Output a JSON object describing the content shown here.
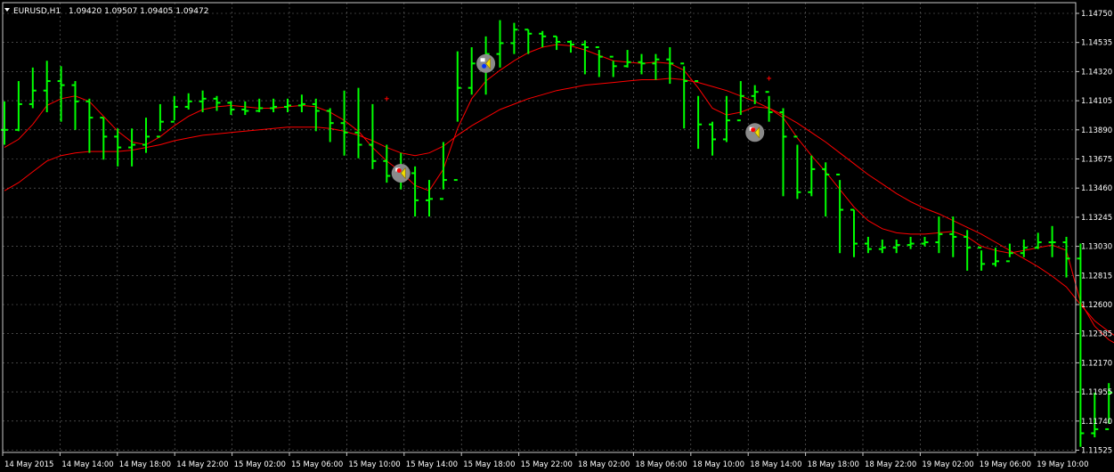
{
  "header": {
    "symbol": "EURUSD,H1",
    "quote": "1.09420 1.09507 1.09405 1.09472"
  },
  "colors": {
    "background": "#000000",
    "grid": "#6e6e6e",
    "bar": "#00ff00",
    "ma": "#ff0000",
    "axis_text": "#ffffff",
    "frame": "#c8c8c8"
  },
  "chart_data": {
    "type": "ohlc",
    "timeframe": "H1",
    "grid": true,
    "ylim": [
      1.11525,
      1.1475
    ],
    "y_ticks": [
      "1.14750",
      "1.14535",
      "1.14320",
      "1.14105",
      "1.13890",
      "1.13675",
      "1.13460",
      "1.13245",
      "1.13030",
      "1.12815",
      "1.12600",
      "1.12385",
      "1.12170",
      "1.11955",
      "1.11740",
      "1.11525"
    ],
    "x_ticks": [
      "14 May 2015",
      "14 May 14:00",
      "14 May 18:00",
      "14 May 22:00",
      "15 May 02:00",
      "15 May 06:00",
      "15 May 10:00",
      "15 May 14:00",
      "15 May 18:00",
      "15 May 22:00",
      "18 May 02:00",
      "18 May 06:00",
      "18 May 10:00",
      "18 May 14:00",
      "18 May 18:00",
      "18 May 22:00",
      "19 May 02:00",
      "19 May 06:00",
      "19 May 10:00"
    ],
    "series": [
      {
        "kind": "bars",
        "close": [
          1.1389,
          1.1408,
          1.1418,
          1.1425,
          1.1422,
          1.141,
          1.1398,
          1.1384,
          1.1376,
          1.1378,
          1.1384,
          1.1395,
          1.1406,
          1.141,
          1.1412,
          1.1409,
          1.1404,
          1.1403,
          1.1405,
          1.1406,
          1.1407,
          1.1408,
          1.1403,
          1.1394,
          1.1387,
          1.1378,
          1.1366,
          1.1355,
          1.1357,
          1.1337,
          1.1338,
          1.1352,
          1.142,
          1.1438,
          1.1445,
          1.1453,
          1.1463,
          1.146,
          1.1458,
          1.1454,
          1.1452,
          1.145,
          1.1443,
          1.1436,
          1.1439,
          1.1438,
          1.1441,
          1.1438,
          1.1425,
          1.1393,
          1.1382,
          1.1396,
          1.1414,
          1.1417,
          1.1402,
          1.1384,
          1.1343,
          1.136,
          1.1356,
          1.133,
          1.1305,
          1.1301,
          1.1302,
          1.1304,
          1.1305,
          1.1306,
          1.1312,
          1.131,
          1.1302,
          1.129,
          1.1292,
          1.1298,
          1.1302,
          1.1306,
          1.1306,
          1.1294,
          1.1165,
          1.1168,
          1.1195,
          1.1207
        ],
        "high": [
          1.141,
          1.1425,
          1.1435,
          1.144,
          1.1436,
          1.1425,
          1.1412,
          1.1398,
          1.139,
          1.139,
          1.1398,
          1.1408,
          1.1414,
          1.1416,
          1.1418,
          1.1414,
          1.141,
          1.141,
          1.1412,
          1.1412,
          1.1412,
          1.1415,
          1.1412,
          1.1405,
          1.1418,
          1.142,
          1.1408,
          1.1378,
          1.1372,
          1.1362,
          1.1352,
          1.138,
          1.1447,
          1.145,
          1.1458,
          1.147,
          1.1468,
          1.1463,
          1.1462,
          1.1458,
          1.1455,
          1.1455,
          1.1448,
          1.144,
          1.1448,
          1.1445,
          1.1445,
          1.145,
          1.1436,
          1.1414,
          1.1395,
          1.1414,
          1.1425,
          1.1422,
          1.1414,
          1.1405,
          1.1378,
          1.137,
          1.1365,
          1.1352,
          1.133,
          1.131,
          1.1308,
          1.1308,
          1.131,
          1.131,
          1.1325,
          1.1325,
          1.1315,
          1.13,
          1.1302,
          1.1305,
          1.1308,
          1.1313,
          1.1318,
          1.131,
          1.1305,
          1.1195,
          1.1202,
          1.1215
        ],
        "low": [
          1.1378,
          1.1388,
          1.1405,
          1.1402,
          1.1395,
          1.1389,
          1.1372,
          1.1367,
          1.1362,
          1.1362,
          1.1372,
          1.1388,
          1.1396,
          1.1404,
          1.1402,
          1.1403,
          1.14,
          1.14,
          1.1402,
          1.1402,
          1.1402,
          1.1402,
          1.1388,
          1.138,
          1.137,
          1.1368,
          1.136,
          1.135,
          1.1345,
          1.1325,
          1.1325,
          1.1345,
          1.1395,
          1.1415,
          1.1415,
          1.1435,
          1.1445,
          1.1445,
          1.145,
          1.1448,
          1.1446,
          1.143,
          1.1428,
          1.1428,
          1.1435,
          1.143,
          1.1426,
          1.1423,
          1.139,
          1.1375,
          1.137,
          1.138,
          1.14,
          1.1408,
          1.1395,
          1.134,
          1.1338,
          1.134,
          1.1325,
          1.1298,
          1.1295,
          1.1298,
          1.1298,
          1.1298,
          1.1301,
          1.1303,
          1.1298,
          1.1295,
          1.1285,
          1.1285,
          1.1288,
          1.1295,
          1.1295,
          1.1301,
          1.1295,
          1.128,
          1.1155,
          1.1162,
          1.1172,
          1.1195
        ]
      },
      {
        "kind": "line",
        "role": "fast-ma",
        "values": [
          1.1376,
          1.1382,
          1.1393,
          1.1407,
          1.1412,
          1.1414,
          1.141,
          1.1399,
          1.1388,
          1.138,
          1.1378,
          1.1384,
          1.1392,
          1.1399,
          1.1404,
          1.1406,
          1.1407,
          1.1406,
          1.1405,
          1.1405,
          1.1406,
          1.1407,
          1.1406,
          1.1402,
          1.1396,
          1.1388,
          1.1376,
          1.1366,
          1.1358,
          1.1348,
          1.1344,
          1.136,
          1.139,
          1.1412,
          1.1425,
          1.1433,
          1.144,
          1.1446,
          1.145,
          1.1452,
          1.1451,
          1.1448,
          1.1444,
          1.144,
          1.1439,
          1.1438,
          1.1439,
          1.1438,
          1.1433,
          1.142,
          1.1405,
          1.14,
          1.1402,
          1.1406,
          1.1405,
          1.1398,
          1.1383,
          1.137,
          1.1358,
          1.1345,
          1.1332,
          1.1322,
          1.1316,
          1.1313,
          1.1312,
          1.1312,
          1.1313,
          1.1314,
          1.131,
          1.1303,
          1.13,
          1.1298,
          1.13,
          1.1302,
          1.1304,
          1.13,
          1.1262,
          1.1244,
          1.1234,
          1.1228
        ]
      },
      {
        "kind": "line",
        "role": "slow-ma",
        "values": [
          1.1344,
          1.135,
          1.1358,
          1.1366,
          1.137,
          1.1372,
          1.1373,
          1.1373,
          1.1373,
          1.1374,
          1.1376,
          1.1378,
          1.1381,
          1.1383,
          1.1385,
          1.1386,
          1.1387,
          1.1388,
          1.1389,
          1.139,
          1.1391,
          1.1391,
          1.1391,
          1.139,
          1.1388,
          1.1385,
          1.1381,
          1.1376,
          1.1372,
          1.137,
          1.1372,
          1.1377,
          1.1385,
          1.1392,
          1.1398,
          1.1404,
          1.1408,
          1.1412,
          1.1415,
          1.1418,
          1.142,
          1.1422,
          1.1423,
          1.1424,
          1.1425,
          1.1426,
          1.1426,
          1.1427,
          1.1426,
          1.1424,
          1.1421,
          1.1418,
          1.1414,
          1.141,
          1.1405,
          1.14,
          1.1394,
          1.1387,
          1.138,
          1.1372,
          1.1364,
          1.1356,
          1.1349,
          1.1342,
          1.1336,
          1.1331,
          1.1327,
          1.1322,
          1.1317,
          1.1312,
          1.1306,
          1.13,
          1.1294,
          1.1288,
          1.1281,
          1.1273,
          1.126,
          1.1248,
          1.124,
          1.1233
        ]
      }
    ],
    "markers": [
      {
        "bar": 28,
        "price": 1.1357,
        "type": "sell"
      },
      {
        "bar": 34,
        "price": 1.1438,
        "type": "buy"
      },
      {
        "bar": 53,
        "price": 1.1387,
        "type": "sell"
      }
    ],
    "crosses": [
      {
        "bar": 27,
        "price": 1.1412
      },
      {
        "bar": 54,
        "price": 1.1427
      }
    ]
  }
}
